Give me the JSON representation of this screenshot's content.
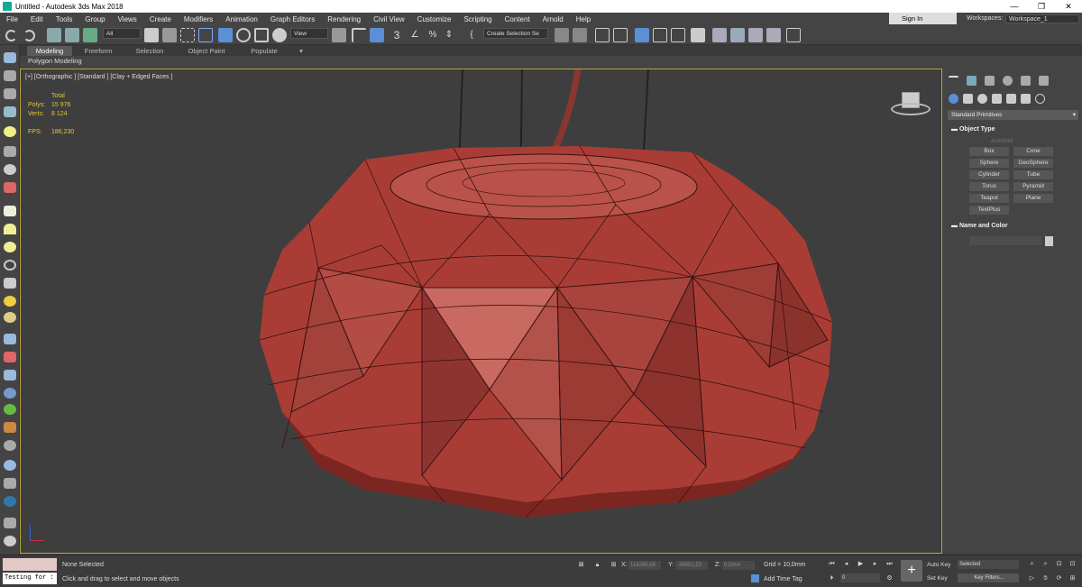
{
  "window": {
    "title": "Untitled - Autodesk 3ds Max 2018",
    "minimize": "—",
    "maximize": "❐",
    "close": "✕"
  },
  "menu": [
    "File",
    "Edit",
    "Tools",
    "Group",
    "Views",
    "Create",
    "Modifiers",
    "Animation",
    "Graph Editors",
    "Rendering",
    "Civil View",
    "Customize",
    "Scripting",
    "Content",
    "Arnold",
    "Help"
  ],
  "account": {
    "signin": "Sign In",
    "workspaces_label": "Workspaces:",
    "workspace": "Workspace_1"
  },
  "toolbar": {
    "filter": "All",
    "view": "View",
    "selection_set": "Create Selection Se",
    "snap_value": "3"
  },
  "ribbon": {
    "tabs": [
      "Modeling",
      "Freeform",
      "Selection",
      "Object Paint",
      "Populate"
    ],
    "active": "Modeling",
    "sub": "Polygon Modeling"
  },
  "viewport": {
    "label": "[+] [Orthographic ] [Standard ] [Clay + Edged Faces ]",
    "stats": {
      "total": "Total",
      "polys_label": "Polys:",
      "polys": "15 976",
      "verts_label": "Verts:",
      "verts": "8 124",
      "fps_label": "FPS:",
      "fps": "186,230"
    }
  },
  "command_panel": {
    "category": "Standard Primitives",
    "object_type": "Object Type",
    "autogrid": "AutoGrid",
    "buttons": [
      "Box",
      "Cone",
      "Sphere",
      "GeoSphere",
      "Cylinder",
      "Tube",
      "Torus",
      "Pyramid",
      "Teapot",
      "Plane",
      "TextPlus"
    ],
    "name_and_color": "Name and Color"
  },
  "status": {
    "maxscript": "Testing for :",
    "selected": "None Selected",
    "prompt": "Click and drag to select and move objects",
    "x_label": "X:",
    "x": "114265,65",
    "y_label": "Y:",
    "y": "-36051,53",
    "z_label": "Z:",
    "z": "0,0mm",
    "grid": "Grid = 10,0mm",
    "add_time_tag": "Add Time Tag",
    "frame": "0",
    "auto_key": "Auto Key",
    "set_key": "Set Key",
    "key_mode": "Selected",
    "key_filters": "Key Filters..."
  },
  "colors": {
    "accent": "#5b8fd6",
    "viewport_border": "#b8a33a",
    "stats": "#e6c830",
    "mesh": "#b84a42"
  }
}
